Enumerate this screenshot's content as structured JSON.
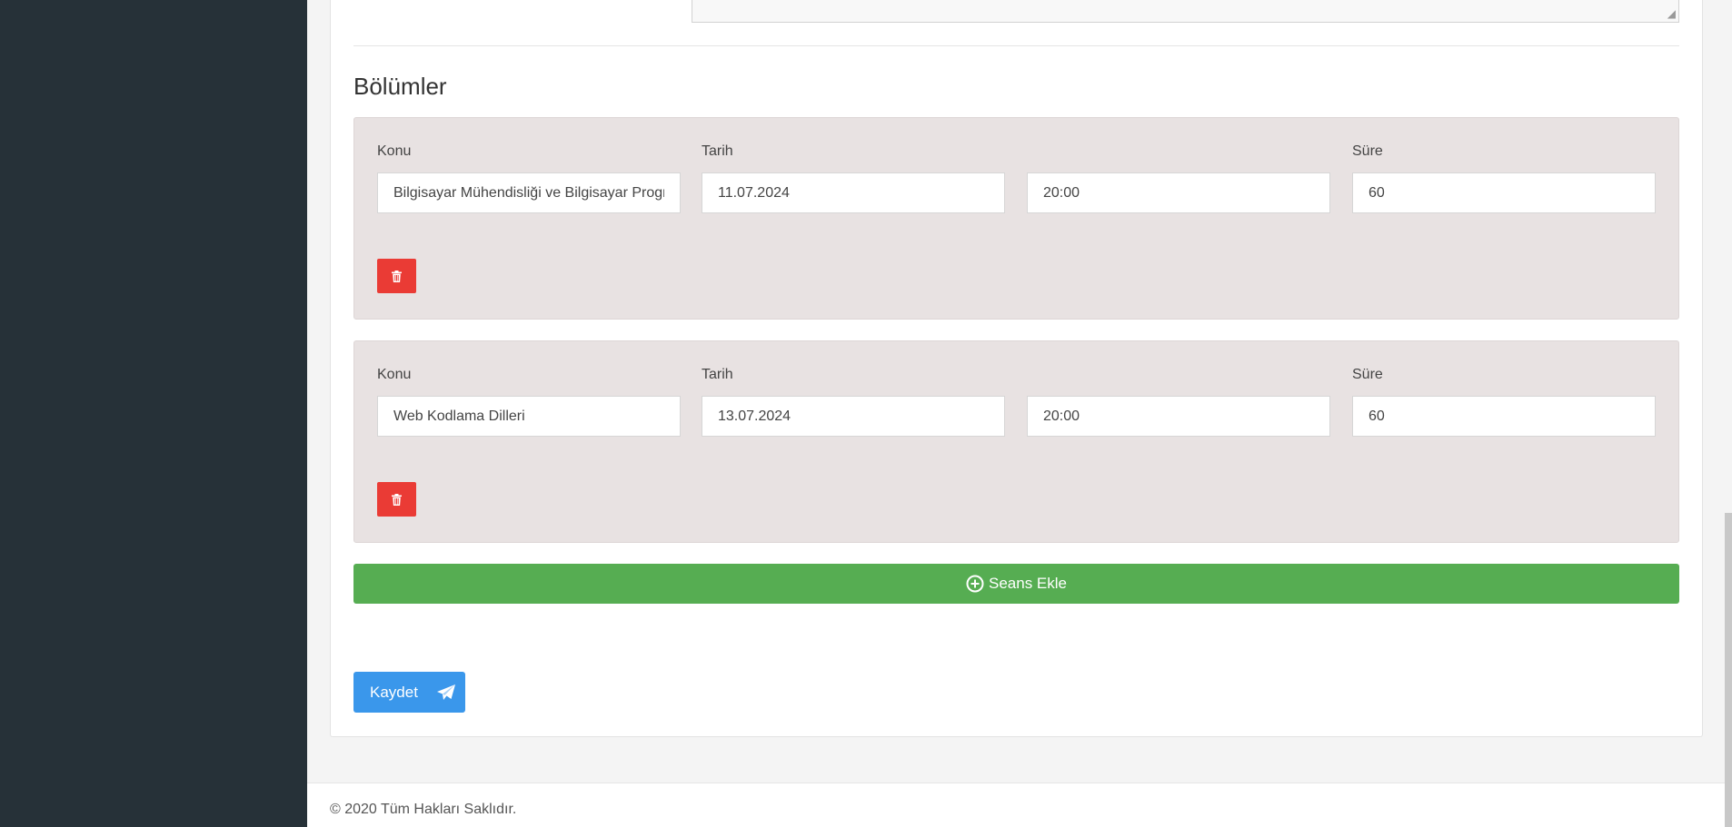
{
  "sections": {
    "title": "Bölümler"
  },
  "sessions": [
    {
      "konu_label": "Konu",
      "tarih_label": "Tarih",
      "sure_label": "Süre",
      "konu": "Bilgisayar Mühendisliği ve Bilgisayar Programcılığı",
      "tarih": "11.07.2024",
      "saat": "20:00",
      "sure": "60"
    },
    {
      "konu_label": "Konu",
      "tarih_label": "Tarih",
      "sure_label": "Süre",
      "konu": "Web Kodlama Dilleri",
      "tarih": "13.07.2024",
      "saat": "20:00",
      "sure": "60"
    }
  ],
  "actions": {
    "add_session": "Seans Ekle",
    "save": "Kaydet"
  },
  "footer": {
    "copyright": "© 2020 Tüm Hakları Saklıdır."
  },
  "icons": {
    "delete": "trash-icon",
    "add": "plus-circle-icon",
    "save": "paper-plane-icon"
  },
  "colors": {
    "sidebar": "#263138",
    "session_bg": "#e8e2e2",
    "delete": "#ea3b35",
    "add": "#56ad52",
    "save": "#3a97eb"
  }
}
